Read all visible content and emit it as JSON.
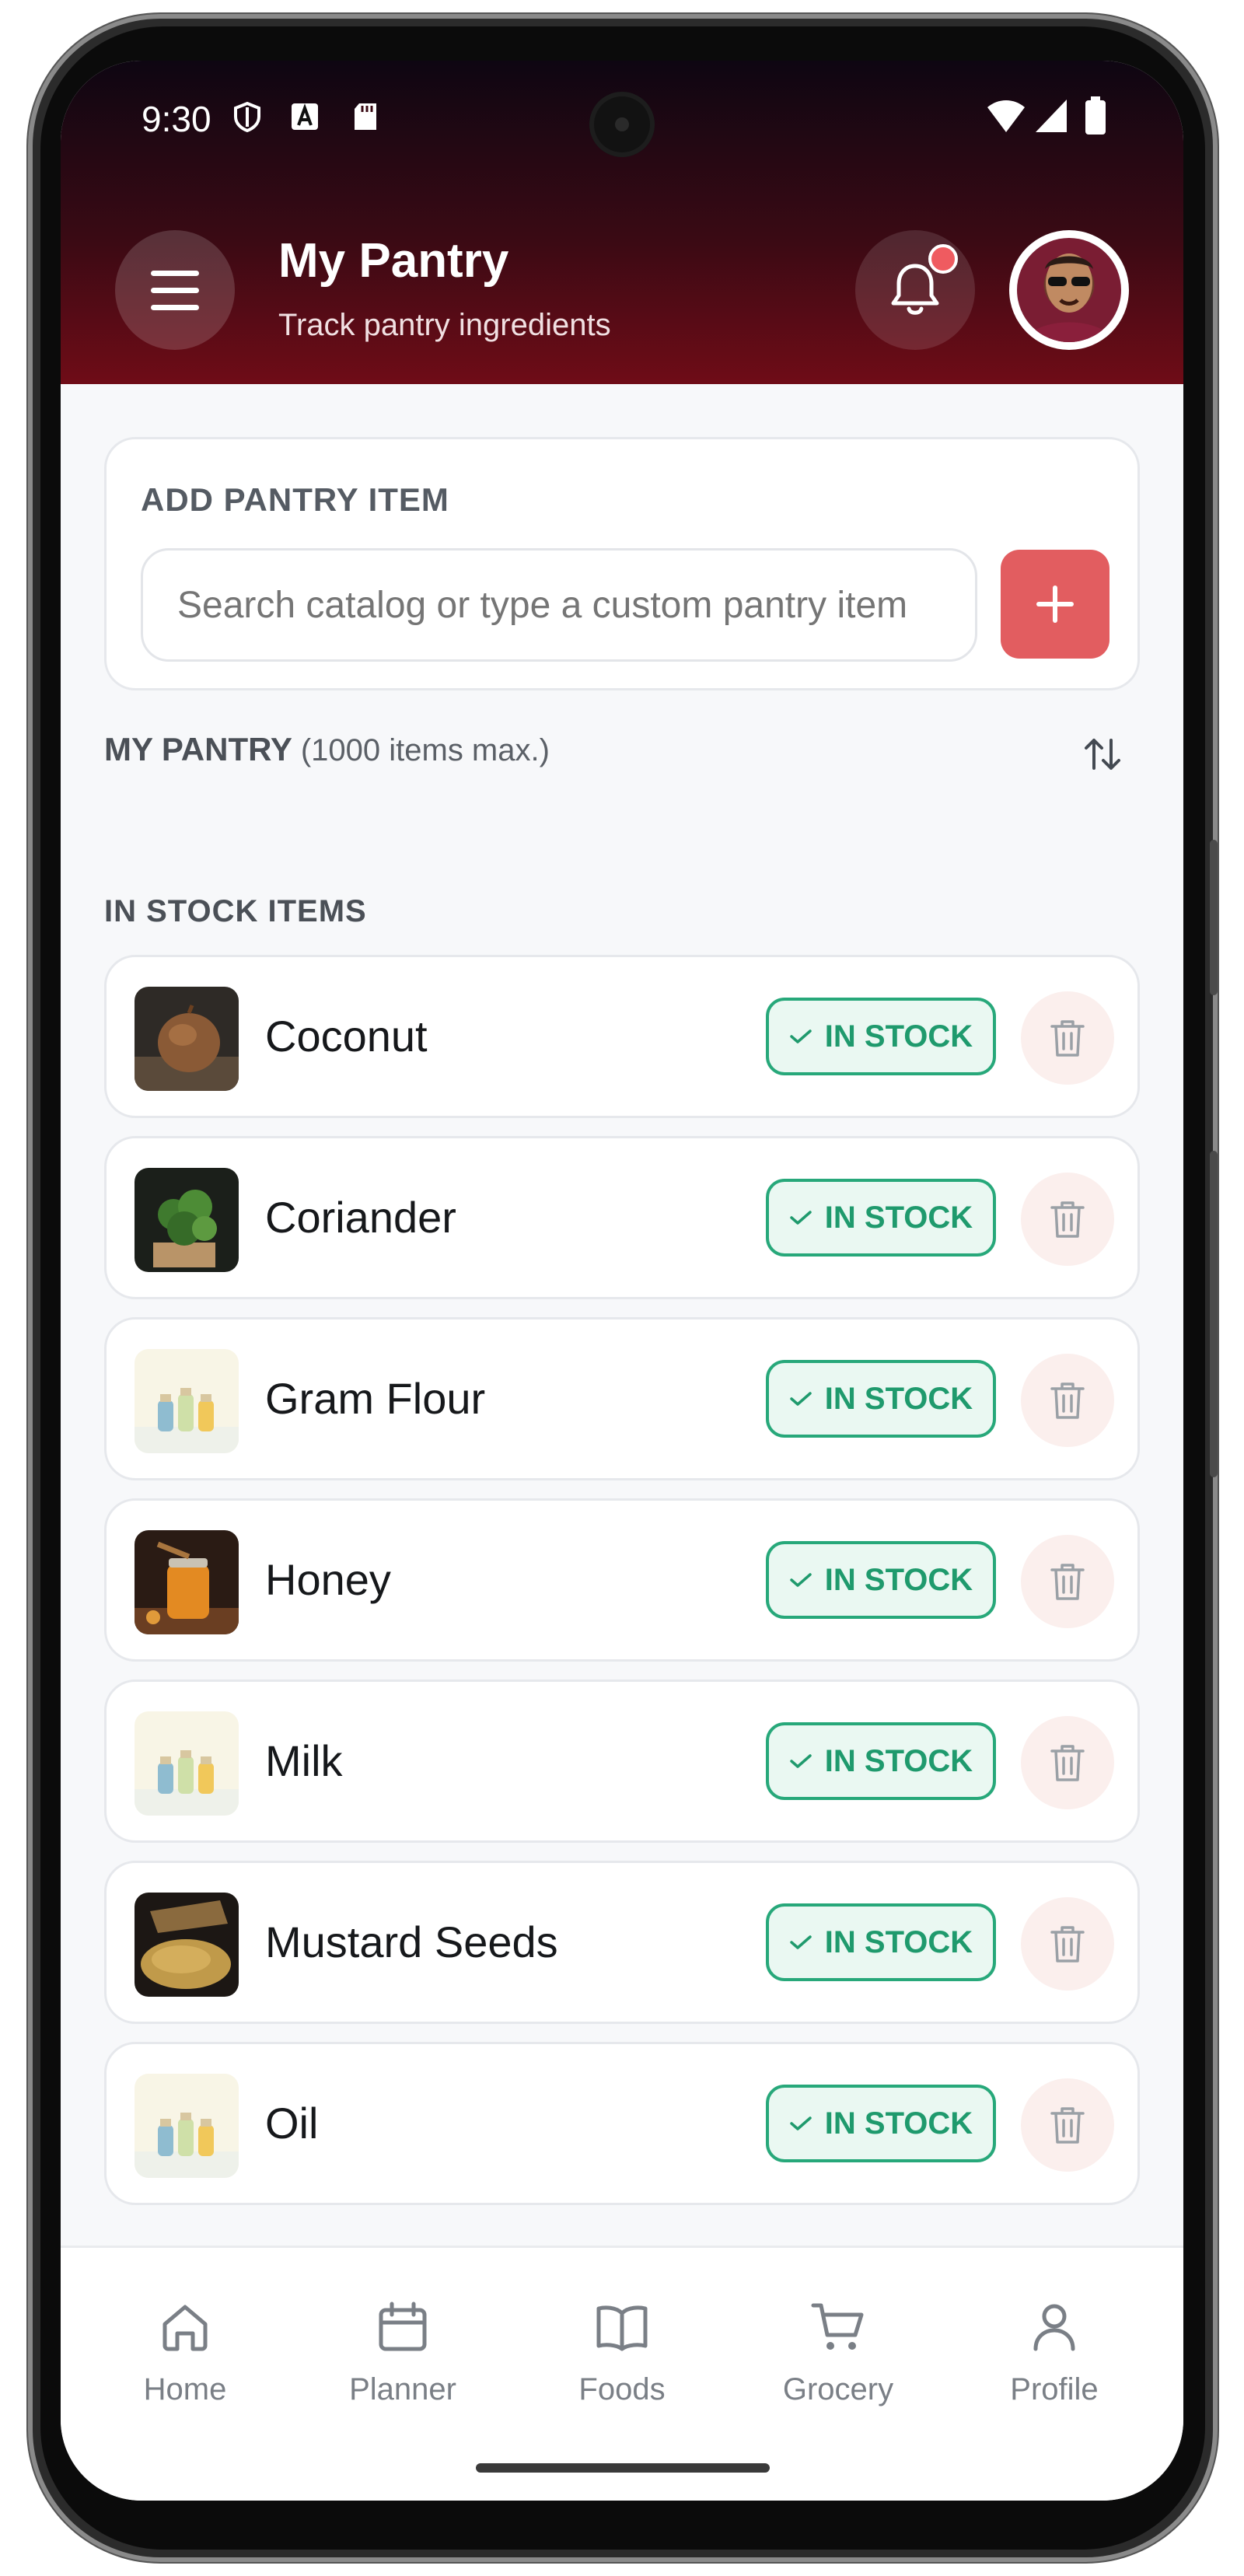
{
  "status_bar": {
    "time": "9:30"
  },
  "header": {
    "title": "My Pantry",
    "subtitle": "Track pantry ingredients"
  },
  "add_card": {
    "title": "ADD PANTRY ITEM",
    "search_placeholder": "Search catalog or type a custom pantry item"
  },
  "pantry": {
    "title": "MY PANTRY",
    "limit_note": "(1000 items max.)",
    "in_stock_heading": "IN STOCK ITEMS",
    "items": [
      {
        "name": "Coconut",
        "status": "IN STOCK",
        "thumb": "coconut"
      },
      {
        "name": "Coriander",
        "status": "IN STOCK",
        "thumb": "coriander"
      },
      {
        "name": "Gram Flour",
        "status": "IN STOCK",
        "thumb": "jars"
      },
      {
        "name": "Honey",
        "status": "IN STOCK",
        "thumb": "honey"
      },
      {
        "name": "Milk",
        "status": "IN STOCK",
        "thumb": "jars"
      },
      {
        "name": "Mustard Seeds",
        "status": "IN STOCK",
        "thumb": "mustard"
      },
      {
        "name": "Oil",
        "status": "IN STOCK",
        "thumb": "jars"
      }
    ]
  },
  "bottom_nav": [
    {
      "label": "Home",
      "icon": "home-icon"
    },
    {
      "label": "Planner",
      "icon": "calendar-icon"
    },
    {
      "label": "Foods",
      "icon": "book-icon"
    },
    {
      "label": "Grocery",
      "icon": "cart-icon"
    },
    {
      "label": "Profile",
      "icon": "person-icon"
    }
  ],
  "colors": {
    "header_dark": "#0e0612",
    "header_red": "#6f0c17",
    "accent": "#e25d60",
    "in_stock_green": "#27a87a"
  }
}
